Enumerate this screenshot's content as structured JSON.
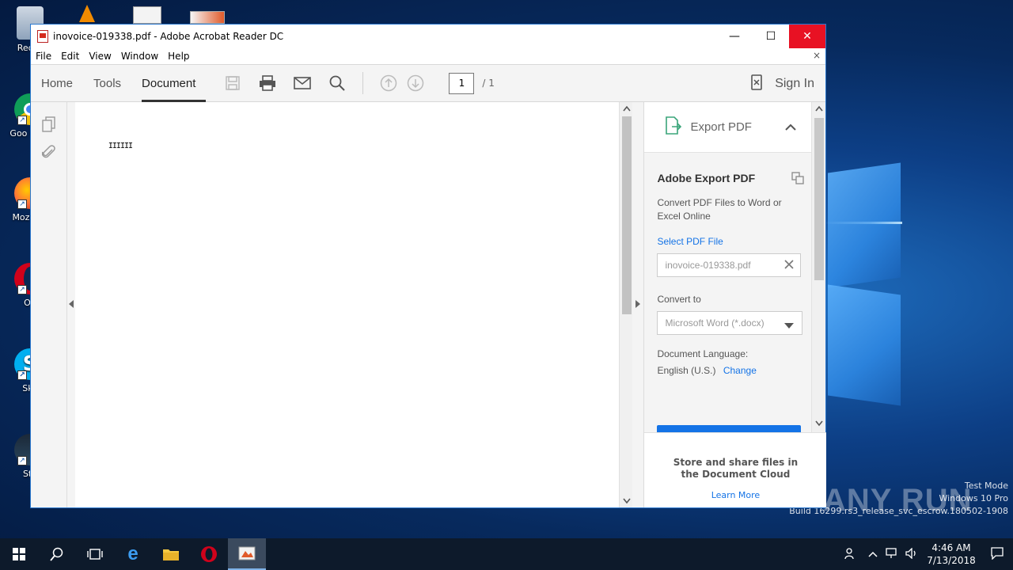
{
  "window": {
    "title": "inovoice-019338.pdf - Adobe Acrobat Reader DC",
    "minimize_glyph": "—",
    "maximize_glyph": "☐",
    "close_glyph": "✕"
  },
  "menu": {
    "items": [
      "File",
      "Edit",
      "View",
      "Window",
      "Help"
    ],
    "close_glyph": "×"
  },
  "toolbar": {
    "tabs": [
      "Home",
      "Tools",
      "Document"
    ],
    "active_tab": "Document",
    "page_current": "1",
    "page_total": "/  1",
    "sign_in": "Sign In"
  },
  "document": {
    "barcode_text": "IIIIII"
  },
  "right_panel": {
    "header": "Export PDF",
    "title": "Adobe Export PDF",
    "description": "Convert PDF Files to Word or Excel Online",
    "select_label": "Select PDF File",
    "file_value": "inovoice-019338.pdf",
    "convert_label": "Convert to",
    "convert_value": "Microsoft Word (*.docx)",
    "language_label": "Document Language:",
    "language_value": "English (U.S.)",
    "change_link": "Change",
    "footer_text": "Store and share files in the Document Cloud",
    "learn_more": "Learn More"
  },
  "desktop": {
    "icons": [
      "Recyc",
      "Goo Chro",
      "Moz Fire",
      "Op",
      "Sky",
      "Ste"
    ]
  },
  "watermark": {
    "brand": "ANY RUN",
    "line1": "Test Mode",
    "line2": "Windows 10 Pro",
    "line3": "Build 16299.rs3_release_svc_escrow.180502-1908"
  },
  "taskbar": {
    "time": "4:46 AM",
    "date": "7/13/2018"
  },
  "colors": {
    "accent_blue": "#1473e6",
    "close_red": "#e81123",
    "export_green": "#3aa57a"
  }
}
